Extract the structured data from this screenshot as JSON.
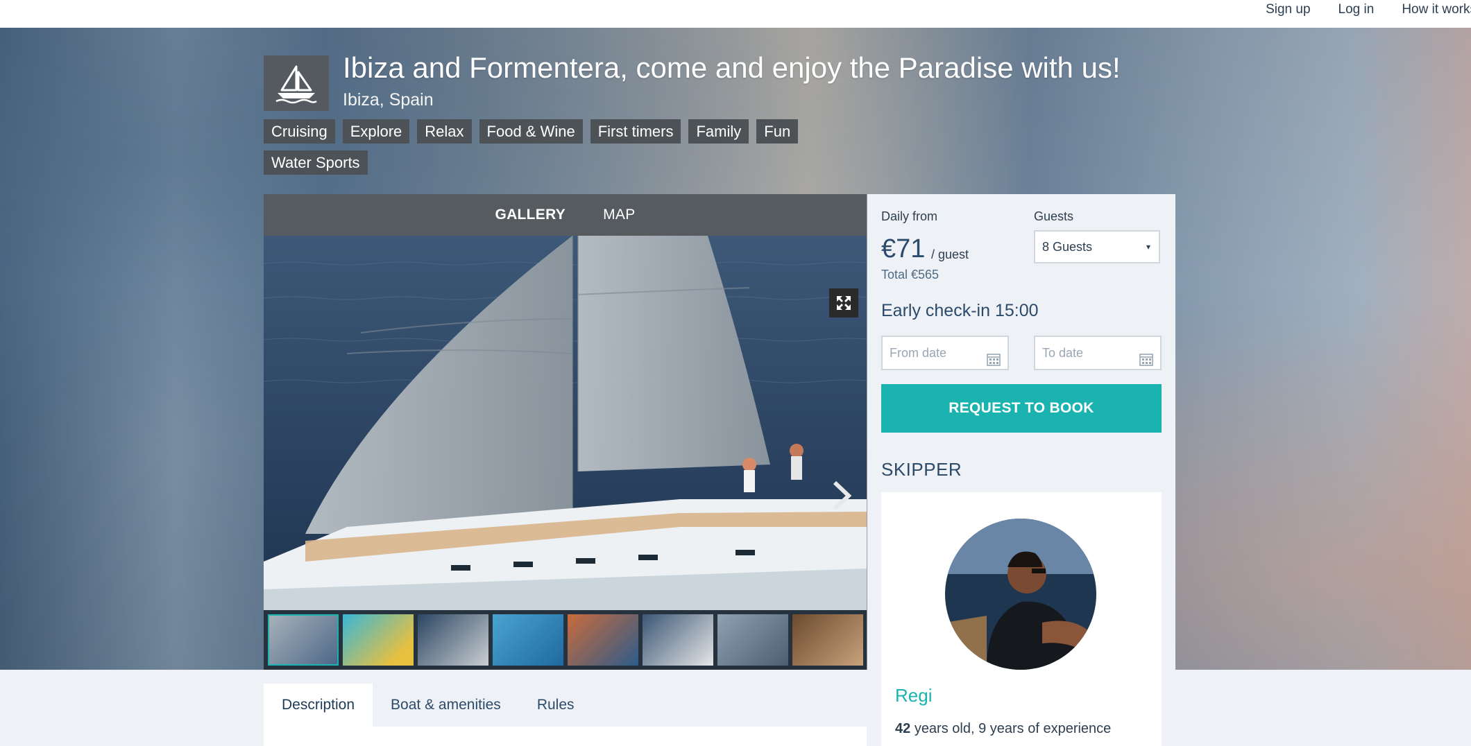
{
  "nav": {
    "signup": "Sign up",
    "login": "Log in",
    "how": "How it works"
  },
  "listing": {
    "title": "Ibiza and Formentera, come and enjoy the Paradise with us!",
    "location": "Ibiza, Spain",
    "tags": [
      "Cruising",
      "Explore",
      "Relax",
      "Food & Wine",
      "First timers",
      "Family",
      "Fun",
      "Water Sports"
    ]
  },
  "gallery": {
    "tabs": [
      "GALLERY",
      "MAP"
    ],
    "active_tab": "GALLERY",
    "thumbnail_count": 8,
    "selected_thumbnail": 1
  },
  "booking": {
    "daily_from_label": "Daily from",
    "price": "€71",
    "per": "/ guest",
    "total": "Total €565",
    "guests_label": "Guests",
    "guests_value": "8 Guests",
    "checkin": "Early check-in 15:00",
    "from_placeholder": "From date",
    "to_placeholder": "To date",
    "cta": "REQUEST TO BOOK"
  },
  "skipper": {
    "heading": "SKIPPER",
    "name": "Regi",
    "age": "42",
    "meta": "years old, 9 years of experience"
  },
  "desc_tabs": [
    "Description",
    "Boat & amenities",
    "Rules"
  ],
  "colors": {
    "accent": "#1ab3b0",
    "tag_bg": "#4d5257",
    "tab_bar": "#565b60"
  },
  "icons": [
    "sailboat-logo",
    "expand-icon",
    "chevron-right-icon",
    "calendar-icon",
    "caret-down-icon"
  ]
}
